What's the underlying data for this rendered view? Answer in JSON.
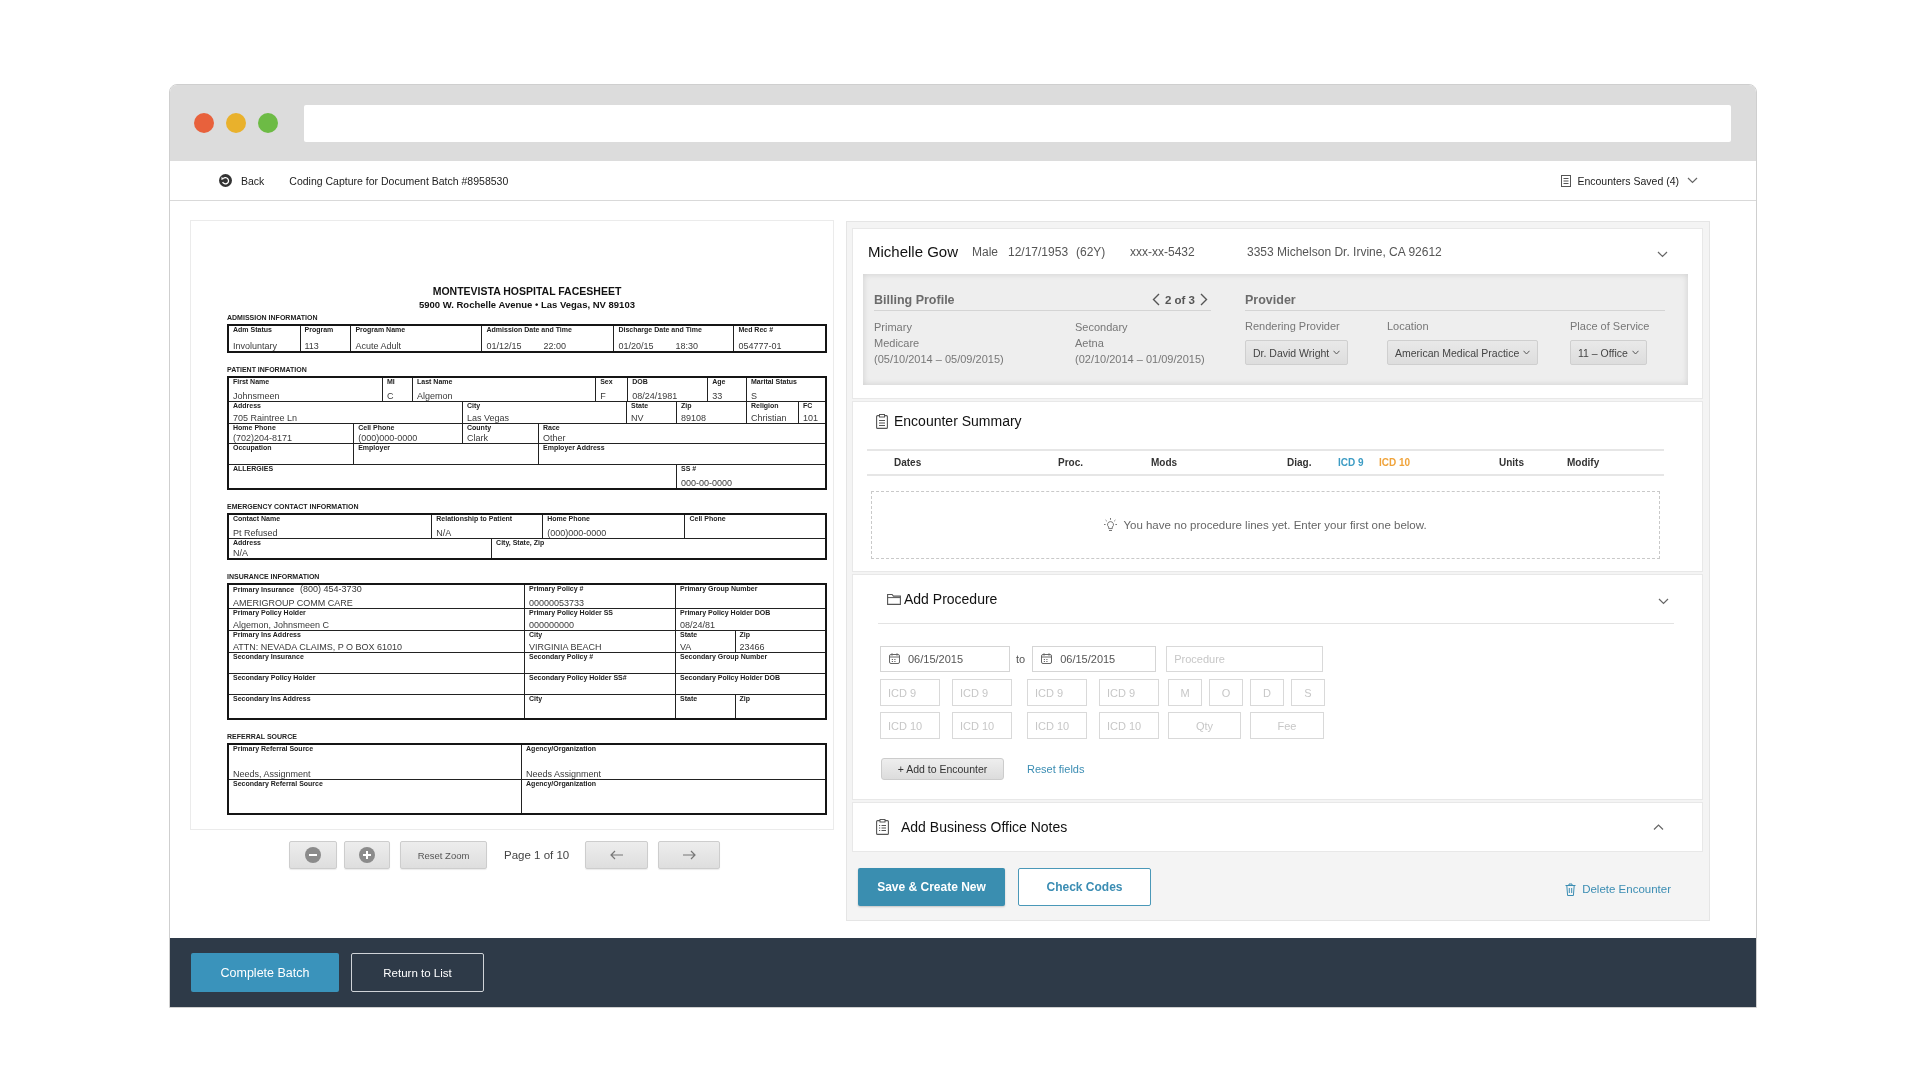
{
  "top_bar": {
    "back": "Back",
    "title": "Coding Capture for Document Batch #8958530",
    "encounters_saved": "Encounters Saved (4)"
  },
  "document": {
    "title": "MONTEVISTA HOSPITAL FACESHEET",
    "address": "5900 W. Rochelle Avenue • Las Vegas, NV 89103",
    "sections": [
      {
        "heading": "ADMISSION INFORMATION",
        "lines": [
          {
            "fields": [
              {
                "label": "Adm Status",
                "value": "Involuntary"
              },
              {
                "label": "Program",
                "value": "113"
              },
              {
                "label": "Program Name",
                "value": "Acute Adult"
              },
              {
                "label": "Admission Date and Time",
                "value": "01/12/15",
                "time": "22:00"
              },
              {
                "label": "Discharge Date and Time",
                "value": "01/20/15",
                "time": "18:30"
              },
              {
                "label": "Med Rec #",
                "value": "054777-01"
              }
            ]
          }
        ]
      },
      {
        "heading": "PATIENT INFORMATION",
        "lines": [
          {
            "fields": [
              {
                "label": "First Name",
                "value": "Johnsmeen"
              },
              {
                "label": "MI",
                "value": "C"
              },
              {
                "label": "Last Name",
                "value": "Algemon"
              },
              {
                "label": "Sex",
                "value": "F"
              },
              {
                "label": "DOB",
                "value": "08/24/1981"
              },
              {
                "label": "Age",
                "value": "33"
              },
              {
                "label": "Marital Status",
                "value": "S"
              }
            ]
          },
          {
            "fields": [
              {
                "label": "Address",
                "value": "705 Raintree Ln"
              },
              {
                "label": "City",
                "value": "Las Vegas"
              },
              {
                "label": "State",
                "value": "NV"
              },
              {
                "label": "Zip",
                "value": "89108"
              },
              {
                "label": "Religion",
                "value": "Christian"
              },
              {
                "label": "FC",
                "value": "101"
              }
            ]
          },
          {
            "fields": [
              {
                "label": "Home Phone",
                "value": "(702)204-8171"
              },
              {
                "label": "Cell Phone",
                "value": "(000)000-0000"
              },
              {
                "label": "County",
                "value": "Clark"
              },
              {
                "label": "Race",
                "value": "Other"
              }
            ]
          },
          {
            "fields": [
              {
                "label": "Occupation"
              },
              {
                "label": "Employer"
              },
              {
                "label": "Employer Address"
              }
            ]
          },
          {
            "fields": [
              {
                "label": "ALLERGIES"
              },
              {
                "label": "SS #",
                "value": "000-00-0000"
              }
            ]
          }
        ]
      },
      {
        "heading": "EMERGENCY CONTACT INFORMATION",
        "lines": [
          {
            "fields": [
              {
                "label": "Contact Name",
                "value": "Pt Refused"
              },
              {
                "label": "Relationship to Patient",
                "value": "N/A"
              },
              {
                "label": "Home Phone",
                "value": "(000)000-0000"
              },
              {
                "label": "Cell Phone"
              }
            ]
          },
          {
            "fields": [
              {
                "label": "Address",
                "value": "N/A"
              },
              {
                "label": "City, State, Zip"
              }
            ]
          }
        ]
      },
      {
        "heading": "INSURANCE INFORMATION",
        "lines": [
          {
            "fields": [
              {
                "label": "Primary Insurance",
                "note": "(800) 454-3730",
                "value": "AMERIGROUP COMM CARE"
              },
              {
                "label": "Primary Policy #",
                "value": "00000053733"
              },
              {
                "label": "Primary Group Number"
              }
            ]
          },
          {
            "fields": [
              {
                "label": "Primary Policy Holder",
                "value": "Algemon, Johnsmeen C"
              },
              {
                "label": "Primary Policy Holder SS",
                "value": "000000000"
              },
              {
                "label": "Primary Policy Holder DOB",
                "value": "08/24/81"
              }
            ]
          },
          {
            "fields": [
              {
                "label": "Primary Ins Address",
                "value": "ATTN: NEVADA CLAIMS, P O BOX 61010"
              },
              {
                "label": "City",
                "value": "VIRGINIA BEACH"
              },
              {
                "label": "State",
                "value": "VA"
              },
              {
                "label": "Zip",
                "value": "23466"
              }
            ]
          },
          {
            "fields": [
              {
                "label": "Secondary Insurance"
              },
              {
                "label": "Secondary Policy #"
              },
              {
                "label": "Secondary Group Number"
              }
            ]
          },
          {
            "fields": [
              {
                "label": "Secondary Policy Holder"
              },
              {
                "label": "Secondary Policy Holder SS#"
              },
              {
                "label": "Secondary Policy Holder DOB"
              }
            ]
          },
          {
            "fields": [
              {
                "label": "Secondary Ins Address"
              },
              {
                "label": "City"
              },
              {
                "label": "State"
              },
              {
                "label": "Zip"
              }
            ]
          }
        ]
      },
      {
        "heading": "REFERRAL SOURCE",
        "lines": [
          {
            "fields": [
              {
                "label": "Primary Referral Source",
                "value": "Needs, Assignment"
              },
              {
                "label": "Agency/Organization",
                "value": "Needs Assignment"
              }
            ]
          },
          {
            "fields": [
              {
                "label": "Secondary Referral Source"
              },
              {
                "label": "Agency/Organization"
              }
            ]
          }
        ]
      }
    ]
  },
  "viewer_controls": {
    "reset_zoom": "Reset Zoom",
    "page_label": "Page 1 of 10"
  },
  "patient": {
    "name": "Michelle Gow",
    "sex": "Male",
    "dob": "12/17/1953",
    "age": "(62Y)",
    "ssn": "xxx-xx-5432",
    "address": "3353 Michelson Dr. Irvine, CA 92612"
  },
  "billing_profile": {
    "title": "Billing Profile",
    "pager": "2 of 3",
    "coverages": [
      {
        "rank": "Primary",
        "payer": "Medicare",
        "period": "(05/10/2014 – 05/09/2015)"
      },
      {
        "rank": "Secondary",
        "payer": "Aetna",
        "period": "(02/10/2014 – 01/09/2015)"
      }
    ]
  },
  "provider": {
    "title": "Provider",
    "selects": [
      {
        "label": "Rendering Provider",
        "value": "Dr. David Wright"
      },
      {
        "label": "Location",
        "value": "American Medical Practice"
      },
      {
        "label": "Place of Service",
        "value": "11 – Office"
      }
    ]
  },
  "encounter_summary": {
    "title": "Encounter Summary",
    "columns": [
      {
        "label": "Dates"
      },
      {
        "label": "Proc."
      },
      {
        "label": "Mods"
      },
      {
        "label": "Diag."
      },
      {
        "label": "ICD 9",
        "color": "#3d9cc4"
      },
      {
        "label": "ICD 10",
        "color": "#f0a33a"
      },
      {
        "label": "Units"
      },
      {
        "label": "Modify"
      }
    ],
    "empty_message": "You have no procedure lines yet. Enter your first one below."
  },
  "add_procedure": {
    "title": "Add Procedure",
    "date_from": {
      "value": "06/15/2015"
    },
    "range_word": "to",
    "date_to": {
      "value": "06/15/2015"
    },
    "procedure": {
      "placeholder": "Procedure"
    },
    "icd9_fields": [
      {
        "placeholder": "ICD 9"
      },
      {
        "placeholder": "ICD 9"
      },
      {
        "placeholder": "ICD 9"
      },
      {
        "placeholder": "ICD 9"
      }
    ],
    "modifier_fields": [
      {
        "placeholder": "M"
      },
      {
        "placeholder": "O"
      },
      {
        "placeholder": "D"
      },
      {
        "placeholder": "S"
      }
    ],
    "icd10_fields": [
      {
        "placeholder": "ICD 10"
      },
      {
        "placeholder": "ICD 10"
      },
      {
        "placeholder": "ICD 10"
      },
      {
        "placeholder": "ICD 10"
      }
    ],
    "qty": {
      "placeholder": "Qty"
    },
    "fee": {
      "placeholder": "Fee"
    },
    "add_button": "+ Add to Encounter",
    "reset_link": "Reset fields"
  },
  "business_notes": {
    "title": "Add Business Office Notes"
  },
  "actions": {
    "save_button": "Save & Create New",
    "check_button": "Check Codes",
    "delete_link": "Delete Encounter"
  },
  "footer": {
    "complete_button": "Complete Batch",
    "return_button": "Return to List"
  }
}
